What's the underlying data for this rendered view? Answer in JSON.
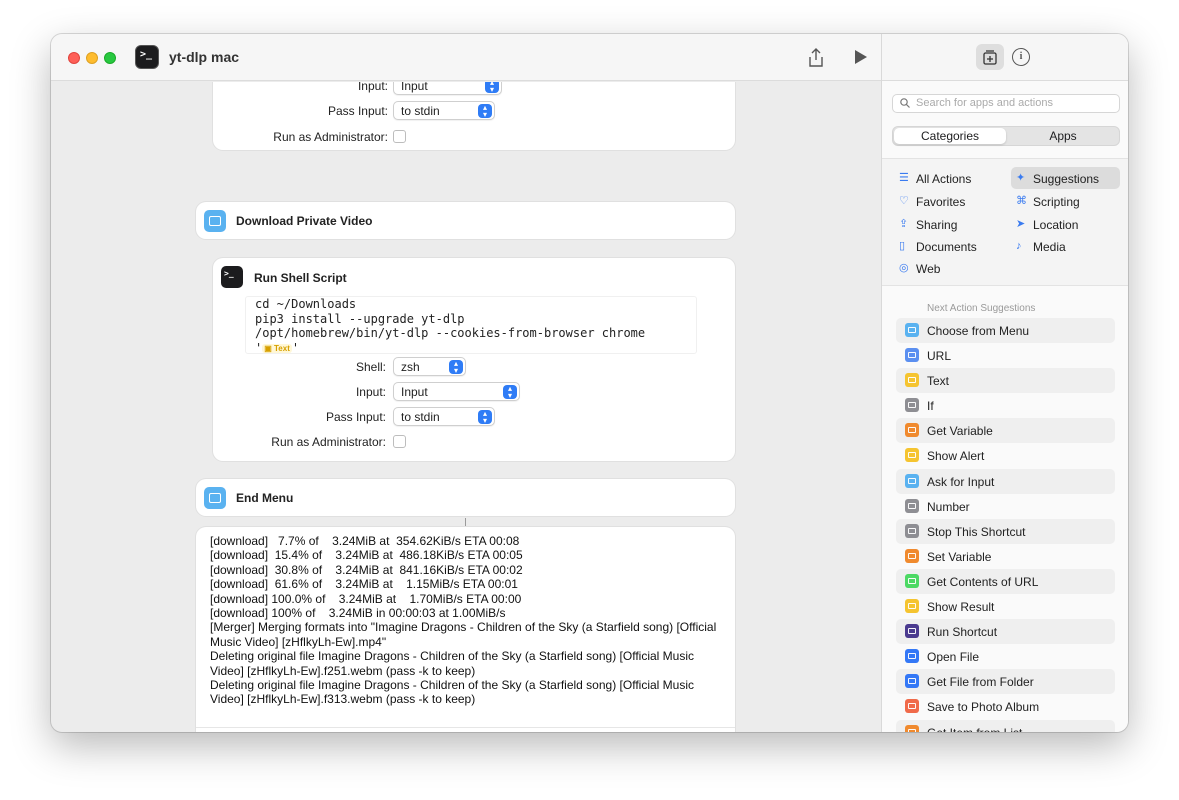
{
  "window": {
    "title": "yt-dlp mac",
    "app_icon_glyph": ">_"
  },
  "editor": {
    "top_card": {
      "input_label": "Input:",
      "input_value": "Input",
      "pass_input_label": "Pass Input:",
      "pass_input_value": "to stdin",
      "admin_label": "Run as Administrator:"
    },
    "download_private": {
      "title": "Download Private Video"
    },
    "shell_card": {
      "title": "Run Shell Script",
      "code_lines": [
        "cd ~/Downloads",
        "pip3 install --upgrade yt-dlp",
        "/opt/homebrew/bin/yt-dlp --cookies-from-browser chrome"
      ],
      "quote_open": "'",
      "token_label": "Text",
      "quote_close": "'",
      "shell_label": "Shell:",
      "shell_value": "zsh",
      "input_label": "Input:",
      "input_value": "Input",
      "pass_input_label": "Pass Input:",
      "pass_input_value": "to stdin",
      "admin_label": "Run as Administrator:"
    },
    "end_menu": {
      "title": "End Menu"
    },
    "output": {
      "lines": [
        "[download]   7.7% of    3.24MiB at  354.62KiB/s ETA 00:08",
        "[download]  15.4% of    3.24MiB at  486.18KiB/s ETA 00:05",
        "[download]  30.8% of    3.24MiB at  841.16KiB/s ETA 00:02",
        "[download]  61.6% of    3.24MiB at    1.15MiB/s ETA 00:01",
        "[download] 100.0% of    3.24MiB at    1.70MiB/s ETA 00:00",
        "[download] 100% of    3.24MiB in 00:00:03 at 1.00MiB/s",
        "[Merger] Merging formats into \"Imagine Dragons - Children of the Sky (a Starfield song) [Official Music Video] [zHflkyLh-Ew].mp4\"",
        "Deleting original file Imagine Dragons - Children of the Sky (a Starfield song) [Official Music Video] [zHflkyLh-Ew].f251.webm (pass -k to keep)",
        "Deleting original file Imagine Dragons - Children of the Sky (a Starfield song) [Official Music Video] [zHflkyLh-Ew].f313.webm (pass -k to keep)"
      ]
    }
  },
  "sidebar": {
    "search_placeholder": "Search for apps and actions",
    "segments": {
      "categories": "Categories",
      "apps": "Apps"
    },
    "categories": [
      {
        "label": "All Actions",
        "icon": "list-icon",
        "selected": false
      },
      {
        "label": "Suggestions",
        "icon": "sparkle-icon",
        "selected": true
      },
      {
        "label": "Favorites",
        "icon": "heart-icon",
        "selected": false
      },
      {
        "label": "Scripting",
        "icon": "scripting-icon",
        "selected": false
      },
      {
        "label": "Sharing",
        "icon": "share-icon",
        "selected": false
      },
      {
        "label": "Location",
        "icon": "location-arrow-icon",
        "selected": false
      },
      {
        "label": "Documents",
        "icon": "document-icon",
        "selected": false
      },
      {
        "label": "Media",
        "icon": "music-note-icon",
        "selected": false
      },
      {
        "label": "Web",
        "icon": "compass-icon",
        "selected": false
      }
    ],
    "suggestions_heading": "Next Action Suggestions",
    "suggestions": [
      {
        "label": "Choose from Menu",
        "icon": "menu-icon",
        "color": "#5ab2f0"
      },
      {
        "label": "URL",
        "icon": "link-icon",
        "color": "#5b8ff0"
      },
      {
        "label": "Text",
        "icon": "text-icon",
        "color": "#f5c430"
      },
      {
        "label": "If",
        "icon": "if-branch-icon",
        "color": "#8e8e93"
      },
      {
        "label": "Get Variable",
        "icon": "variable-icon",
        "color": "#f08a2e"
      },
      {
        "label": "Show Alert",
        "icon": "alert-icon",
        "color": "#f5c430"
      },
      {
        "label": "Ask for Input",
        "icon": "input-bubble-icon",
        "color": "#5ab2f0"
      },
      {
        "label": "Number",
        "icon": "hash-icon",
        "color": "#8e8e93"
      },
      {
        "label": "Stop This Shortcut",
        "icon": "stop-icon",
        "color": "#8e8e93"
      },
      {
        "label": "Set Variable",
        "icon": "variable-icon",
        "color": "#f08a2e"
      },
      {
        "label": "Get Contents of URL",
        "icon": "download-icon",
        "color": "#4cd964"
      },
      {
        "label": "Show Result",
        "icon": "result-icon",
        "color": "#f5c430"
      },
      {
        "label": "Run Shortcut",
        "icon": "shortcuts-icon",
        "color": "#4b3b8f"
      },
      {
        "label": "Open File",
        "icon": "file-icon",
        "color": "#3478f6"
      },
      {
        "label": "Get File from Folder",
        "icon": "folder-icon",
        "color": "#3478f6"
      },
      {
        "label": "Save to Photo Album",
        "icon": "photos-icon",
        "color": "#f06a4a"
      },
      {
        "label": "Get Item from List",
        "icon": "list-item-icon",
        "color": "#f08a2e"
      }
    ]
  }
}
